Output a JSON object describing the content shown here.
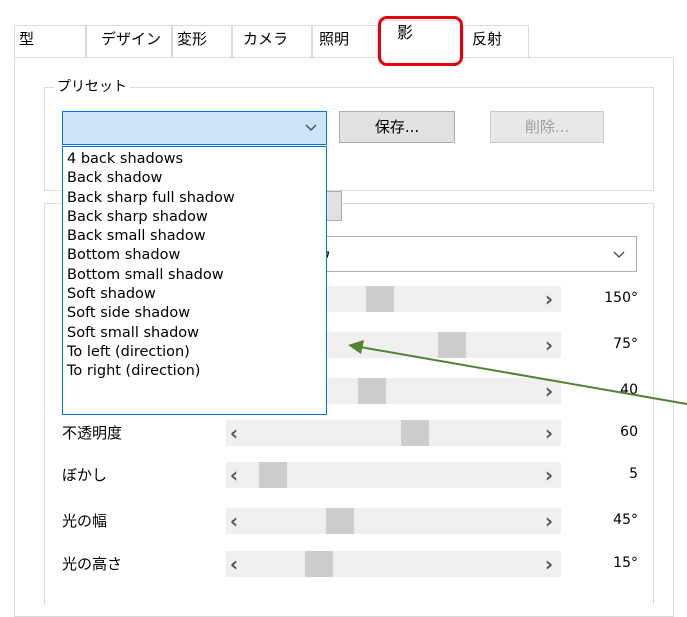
{
  "tabs": [
    {
      "label": "型"
    },
    {
      "label": "デザイン"
    },
    {
      "label": "変形"
    },
    {
      "label": "カメラ"
    },
    {
      "label": "照明"
    },
    {
      "label": "影",
      "active": true
    },
    {
      "label": "反射"
    }
  ],
  "preset": {
    "title": "プリセット",
    "combo_value": "",
    "save_label": "保存...",
    "delete_label": "削除...",
    "options": [
      "4 back shadows",
      "Back shadow",
      "Back sharp full shadow",
      "Back sharp shadow",
      "Back small shadow",
      "Bottom shadow",
      "Bottom small shadow",
      "Soft shadow",
      "Soft side shadow",
      "Soft small shadow",
      "To left (direction)",
      "To right (direction)"
    ]
  },
  "type_combo_partial": "ウ",
  "sliders": [
    {
      "label": "",
      "value": "150°",
      "level": 0.45
    },
    {
      "label": "",
      "value": "75°",
      "level": 0.72
    },
    {
      "label": "",
      "value": "40",
      "level": 0.42
    },
    {
      "label": "不透明度",
      "value": "60",
      "level": 0.58
    },
    {
      "label": "ぼかし",
      "value": "5",
      "level": 0.05
    },
    {
      "label": "光の幅",
      "value": "45°",
      "level": 0.3
    },
    {
      "label": "光の高さ",
      "value": "15°",
      "level": 0.22
    }
  ],
  "colors": {
    "highlight": "#e3000f",
    "arrow": "#548235",
    "combo_focus": "#0078d7"
  }
}
